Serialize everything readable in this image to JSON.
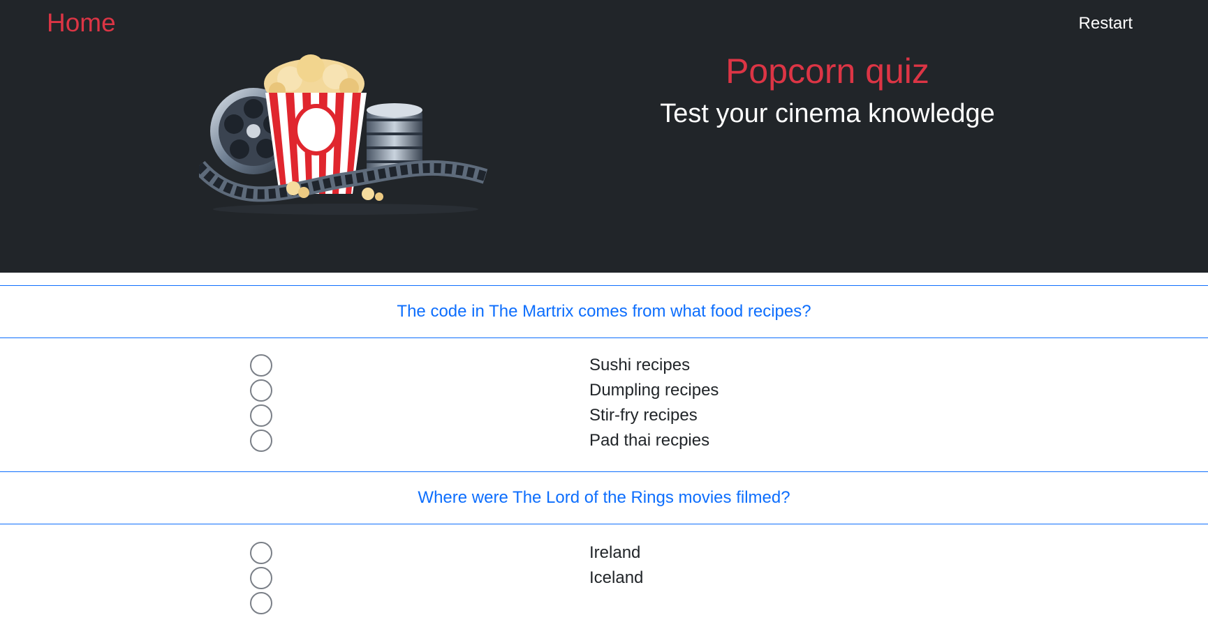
{
  "nav": {
    "home": "Home",
    "restart": "Restart"
  },
  "hero": {
    "title": "Popcorn quiz",
    "subtitle": "Test your cinema knowledge",
    "image": "popcorn-film-reel-illustration"
  },
  "colors": {
    "header_bg": "#212529",
    "accent_red": "#dc3545",
    "link_blue": "#0d6efd",
    "text_dark": "#212529"
  },
  "questions": [
    {
      "text": "The code in The Martrix comes from what food recipes?",
      "options": [
        "Sushi recipes",
        "Dumpling recipes",
        "Stir-fry recipes",
        "Pad thai recpies"
      ]
    },
    {
      "text": "Where were The Lord of the Rings movies filmed?",
      "options": [
        "Ireland",
        "Iceland"
      ]
    }
  ]
}
